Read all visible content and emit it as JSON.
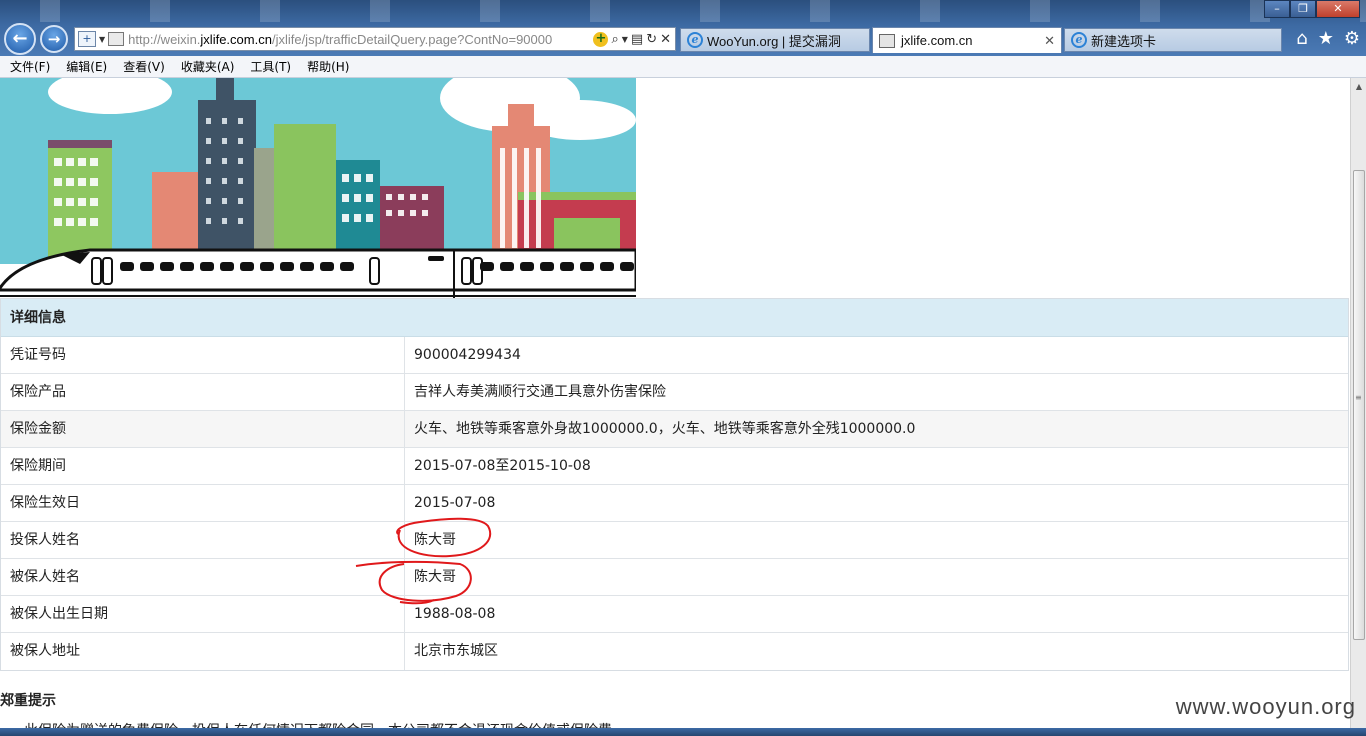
{
  "browser": {
    "url_dim_prefix": "http://weixin.",
    "url_domain": "jxlife.com.cn",
    "url_path": "/jxlife/jsp/trafficDetailQuery.page?ContNo=90000",
    "tabs": [
      {
        "title": "WooYun.org | 提交漏洞",
        "icon": "ie-icon",
        "active": false
      },
      {
        "title": "jxlife.com.cn",
        "icon": "page-icon",
        "active": true
      },
      {
        "title": "新建选项卡",
        "icon": "ie-icon",
        "active": false
      }
    ],
    "menu": [
      "文件(F)",
      "编辑(E)",
      "查看(V)",
      "收藏夹(A)",
      "工具(T)",
      "帮助(H)"
    ]
  },
  "detail": {
    "heading": "详细信息",
    "rows": [
      {
        "label": "凭证号码",
        "value": "900004299434"
      },
      {
        "label": "保险产品",
        "value": "吉祥人寿美满顺行交通工具意外伤害保险"
      },
      {
        "label": "保险金额",
        "value": "火车、地铁等乘客意外身故1000000.0，火车、地铁等乘客意外全残1000000.0"
      },
      {
        "label": "保险期间",
        "value": "2015-07-08至2015-10-08"
      },
      {
        "label": "保险生效日",
        "value": "2015-07-08"
      },
      {
        "label": "投保人姓名",
        "value": "陈大哥"
      },
      {
        "label": "被保人姓名",
        "value": "陈大哥"
      },
      {
        "label": "被保人出生日期",
        "value": "1988-08-08"
      },
      {
        "label": "被保人地址",
        "value": "北京市东城区"
      }
    ]
  },
  "notice": {
    "title": "郑重提示",
    "text": "此保险为赠送的免费保险，投保人在任何情况下都险合同，本公司都不会退还现金价值或保险费"
  },
  "watermark": "www.wooyun.org",
  "colors": {
    "panel_header_bg": "#d9ecf5",
    "annotation": "#e0191b",
    "title_bar": "#3d6aa3"
  }
}
